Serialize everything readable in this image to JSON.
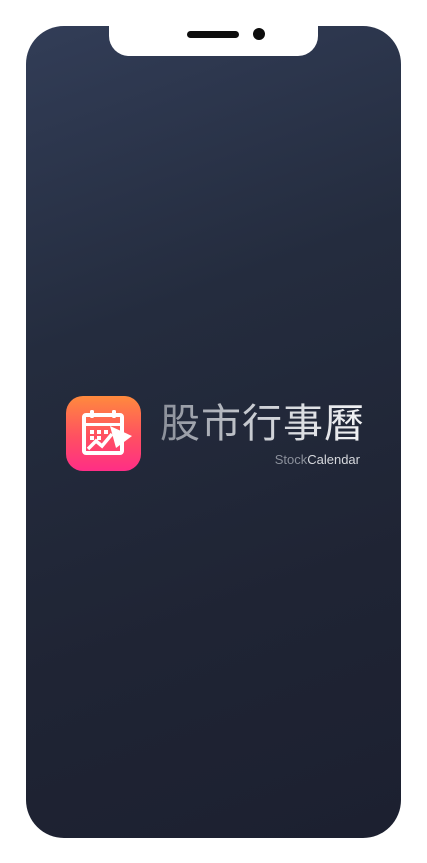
{
  "splash": {
    "brand_title": "股市行事曆",
    "brand_subtitle_part1": "Stock",
    "brand_subtitle_part2": "Calendar",
    "app_icon": "calendar-chart-icon"
  },
  "colors": {
    "background_top": "#323d57",
    "background_bottom": "#1c2030",
    "icon_gradient_top": "#ff8a3d",
    "icon_gradient_bottom": "#ff2e86"
  }
}
